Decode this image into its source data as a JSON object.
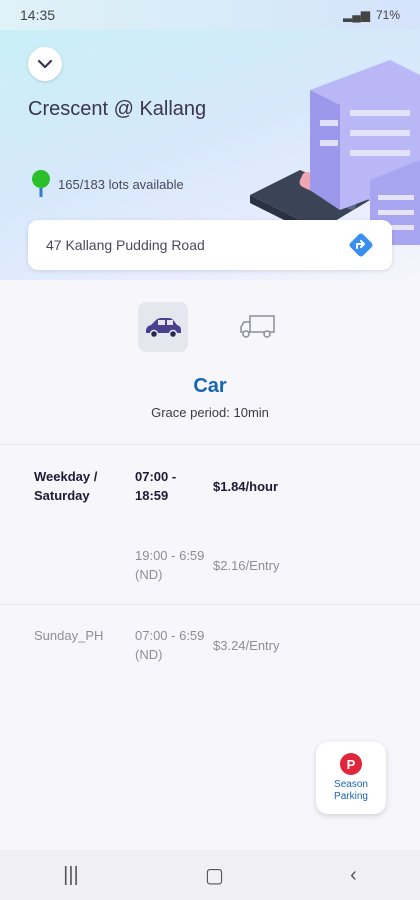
{
  "status": {
    "time": "14:35",
    "battery": "71%"
  },
  "header": {
    "title": "Crescent @ Kallang",
    "lots_text": "165/183 lots available"
  },
  "address": {
    "text": "47 Kallang Pudding Road"
  },
  "vehicle": {
    "selected": "Car",
    "grace": "Grace period: 10min"
  },
  "rates": [
    {
      "day": "Weekday / Saturday",
      "time": "07:00 - 18:59",
      "price": "$1.84/hour"
    },
    {
      "day": "",
      "time": "19:00 - 6:59 (ND)",
      "price": "$2.16/Entry"
    },
    {
      "day": "Sunday_PH",
      "time": "07:00 - 6:59 (ND)",
      "price": "$3.24/Entry"
    }
  ],
  "season": {
    "label_line1": "Season",
    "label_line2": "Parking",
    "badge": "P"
  },
  "colors": {
    "accent": "#1766b3",
    "badge": "#e0263a",
    "pin": "#2bbf2b"
  }
}
